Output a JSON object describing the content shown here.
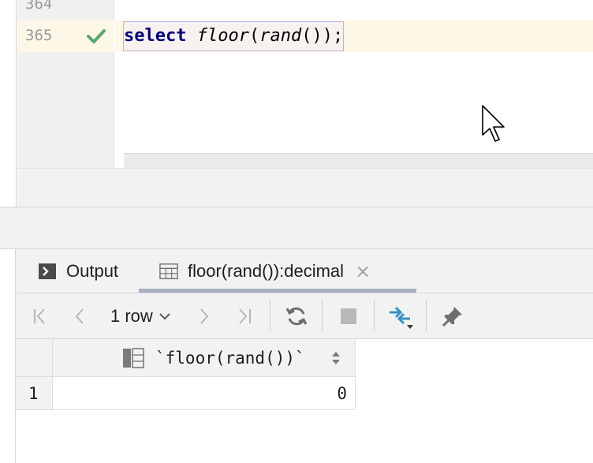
{
  "editor": {
    "line_prev": "364",
    "line_current": "365",
    "code": {
      "keyword": "select",
      "func1": "floor",
      "paren_open": "(",
      "func2": "rand",
      "tail": "());"
    }
  },
  "tabs": {
    "output_label": "Output",
    "result_label": "floor(rand()):decimal",
    "close_glyph": "×"
  },
  "toolbar": {
    "rows_label": "1 row"
  },
  "grid": {
    "columns": [
      "`floor(rand())`"
    ],
    "rows": [
      {
        "index": "1",
        "cells": [
          "0"
        ]
      }
    ]
  },
  "colors": {
    "check": "#59a869",
    "sync_accent": "#3592c4",
    "keyword": "#000080",
    "current_line": "#fcf7e6",
    "selection_border": "#bfb0ee"
  }
}
